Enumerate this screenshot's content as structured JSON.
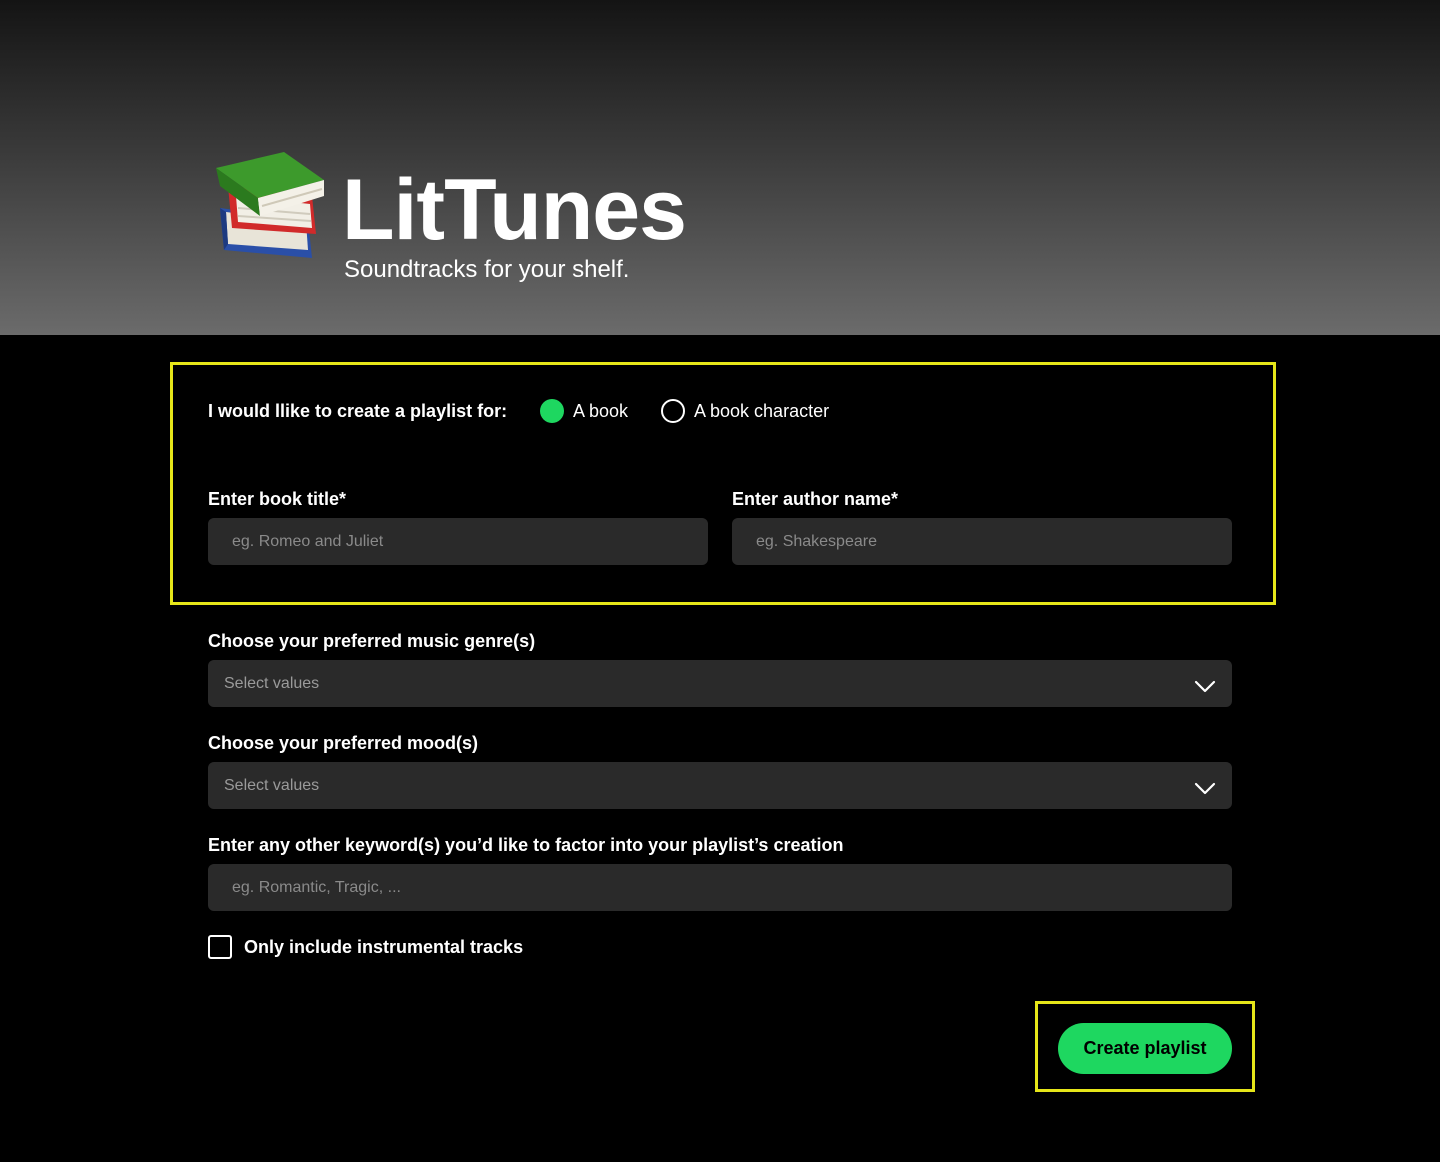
{
  "header": {
    "app_title": "LitTunes",
    "tagline": "Soundtracks for your shelf.",
    "logo_icon": "books-stack-icon"
  },
  "form": {
    "playlist_for_label": "I would llike to create a playlist for:",
    "options": [
      {
        "label": "A book",
        "selected": true
      },
      {
        "label": "A book character",
        "selected": false
      }
    ],
    "book_title": {
      "label": "Enter book title*",
      "placeholder": "eg. Romeo and Juliet",
      "value": ""
    },
    "author_name": {
      "label": "Enter author name*",
      "placeholder": "eg. Shakespeare",
      "value": ""
    },
    "genre": {
      "label": "Choose your preferred music genre(s)",
      "placeholder": "Select values"
    },
    "mood": {
      "label": "Choose your preferred mood(s)",
      "placeholder": "Select values"
    },
    "keywords": {
      "label": "Enter any other keyword(s) you’d like to factor into your playlist’s creation",
      "placeholder": "eg. Romantic, Tragic, ...",
      "value": ""
    },
    "instrumental": {
      "label": "Only include instrumental tracks",
      "checked": false
    },
    "submit_label": "Create playlist"
  },
  "colors": {
    "accent": "#1ed760",
    "highlight": "#e6e619",
    "field_bg": "#2a2a2a",
    "background": "#000000"
  }
}
